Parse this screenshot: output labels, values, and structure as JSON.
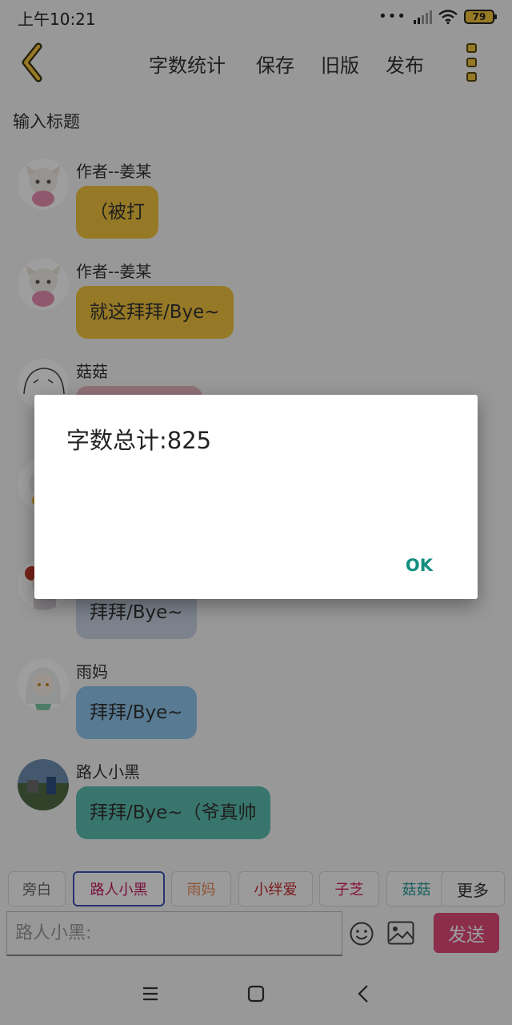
{
  "status_bar": {
    "time": "上午10:21",
    "battery": "79",
    "icons": [
      "dots-icon",
      "signal-icon",
      "wifi-icon",
      "battery-icon"
    ]
  },
  "toolbar": {
    "back_icon": "chevron-left-icon",
    "word_count": "字数统计",
    "save": "保存",
    "old_version": "旧版",
    "publish": "发布",
    "menu_icon": "three-squares-menu-icon"
  },
  "title_input": {
    "placeholder": "输入标题"
  },
  "messages": [
    {
      "sender": "作者--姜某",
      "text": "（被打",
      "bubble_color": "#f2c43e",
      "avatar": "anime-girl-avatar"
    },
    {
      "sender": "作者--姜某",
      "text": "就这拜拜/Bye~",
      "bubble_color": "#f2c43e",
      "avatar": "anime-girl-avatar"
    },
    {
      "sender": "菇菇",
      "text": "",
      "bubble_color": "#e8b6c2",
      "avatar": "sketch-avatar"
    },
    {
      "sender": "",
      "text": "",
      "bubble_color": "#f2c43e",
      "avatar": "anime-girl-avatar"
    },
    {
      "sender": "",
      "text": "拜拜/Bye~",
      "bubble_color": "#c9d4e4",
      "avatar": "red-girl-avatar"
    },
    {
      "sender": "雨妈",
      "text": "拜拜/Bye~",
      "bubble_color": "#8fc6ee",
      "avatar": "white-hair-girl-avatar"
    },
    {
      "sender": "路人小黑",
      "text": "拜拜/Bye~（爷真帅",
      "bubble_color": "#5bbfb1",
      "avatar": "photo-avatar"
    }
  ],
  "dialog": {
    "message": "字数总计:825",
    "ok_label": "OK"
  },
  "characters": [
    {
      "label": "旁白",
      "color": "#666666",
      "selected": false
    },
    {
      "label": "路人小黑",
      "color": "#c2185b",
      "selected": true
    },
    {
      "label": "雨妈",
      "color": "#e6895d",
      "selected": false
    },
    {
      "label": "小绊爱",
      "color": "#c62828",
      "selected": false
    },
    {
      "label": "子芝",
      "color": "#d81b60",
      "selected": false
    },
    {
      "label": "菇菇",
      "color": "#2a9d9a",
      "selected": false
    },
    {
      "label": "更多",
      "color": "#333333",
      "selected": false
    }
  ],
  "compose": {
    "placeholder": "路人小黑:",
    "emoji_icon": "emoji-icon",
    "image_icon": "image-icon",
    "send_label": "发送"
  },
  "nav_bar": {
    "icons": [
      "menu-lines-icon",
      "home-square-icon",
      "back-chevron-icon"
    ]
  }
}
